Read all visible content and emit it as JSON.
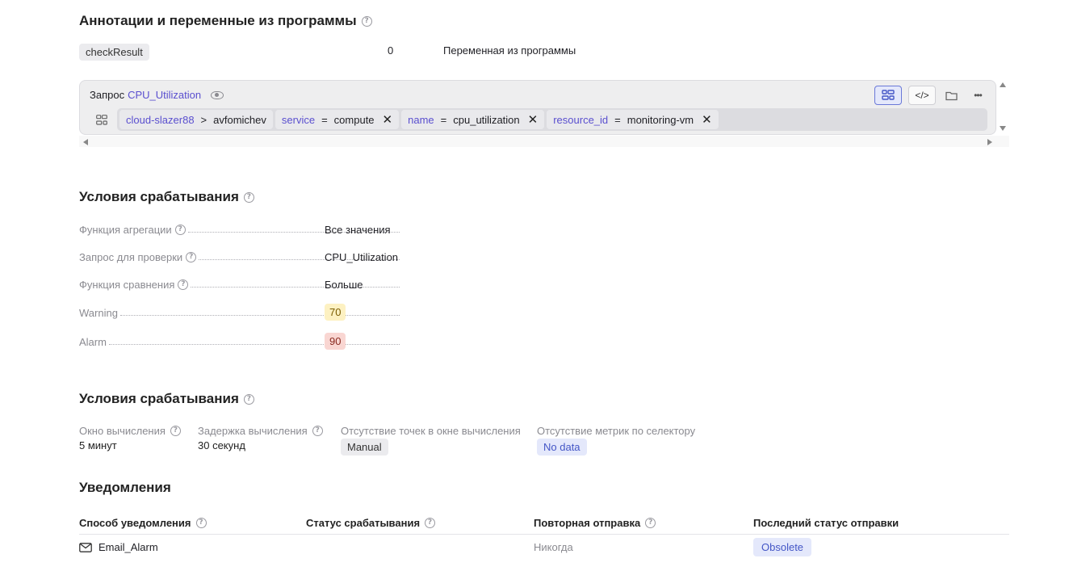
{
  "annotations": {
    "title": "Аннотации и переменные из программы",
    "row": {
      "name": "checkResult",
      "value": "0",
      "description": "Переменная из программы"
    }
  },
  "query": {
    "label": "Запрос",
    "name": "CPU_Utilization",
    "project": "cloud-slazer88",
    "arrow": ">",
    "folder": "avfomichev",
    "selectors": [
      {
        "key": "service",
        "op": "=",
        "value": "compute"
      },
      {
        "key": "name",
        "op": "=",
        "value": "cpu_utilization"
      },
      {
        "key": "resource_id",
        "op": "=",
        "value": "monitoring-vm"
      }
    ],
    "close_glyph": "✕",
    "tool_code_glyph": "</>",
    "tool_more_glyph": "•••"
  },
  "conditions": {
    "title": "Условия срабатывания",
    "rows": [
      {
        "label": "Функция агрегации",
        "value": "Все значения"
      },
      {
        "label": "Запрос для проверки",
        "value": "CPU_Utilization"
      },
      {
        "label": "Функция сравнения",
        "value": "Больше"
      },
      {
        "label": "Warning",
        "value": "70"
      },
      {
        "label": "Alarm",
        "value": "90"
      }
    ]
  },
  "conditions2": {
    "title": "Условия срабатывания",
    "items": [
      {
        "label": "Окно вычисления",
        "value": "5 минут"
      },
      {
        "label": "Задержка вычисления",
        "value": "30 секунд"
      },
      {
        "label": "Отсутствие точек в окне вычисления",
        "value": "Manual"
      },
      {
        "label": "Отсутствие метрик по селектору",
        "value": "No data"
      }
    ]
  },
  "notifications": {
    "title": "Уведомления",
    "columns": [
      "Способ уведомления",
      "Статус срабатывания",
      "Повторная отправка",
      "Последний статус отправки"
    ],
    "rows": [
      {
        "method": "Email_Alarm",
        "status": "",
        "resend": "Никогда",
        "last_status": "Obsolete"
      }
    ]
  },
  "help_glyph": "?",
  "colors": {
    "accent": "#5a4fcf",
    "warning_bg": "#fdf1c2",
    "alarm_bg": "#f9d6d2",
    "info_bg": "#e4e8fb"
  }
}
